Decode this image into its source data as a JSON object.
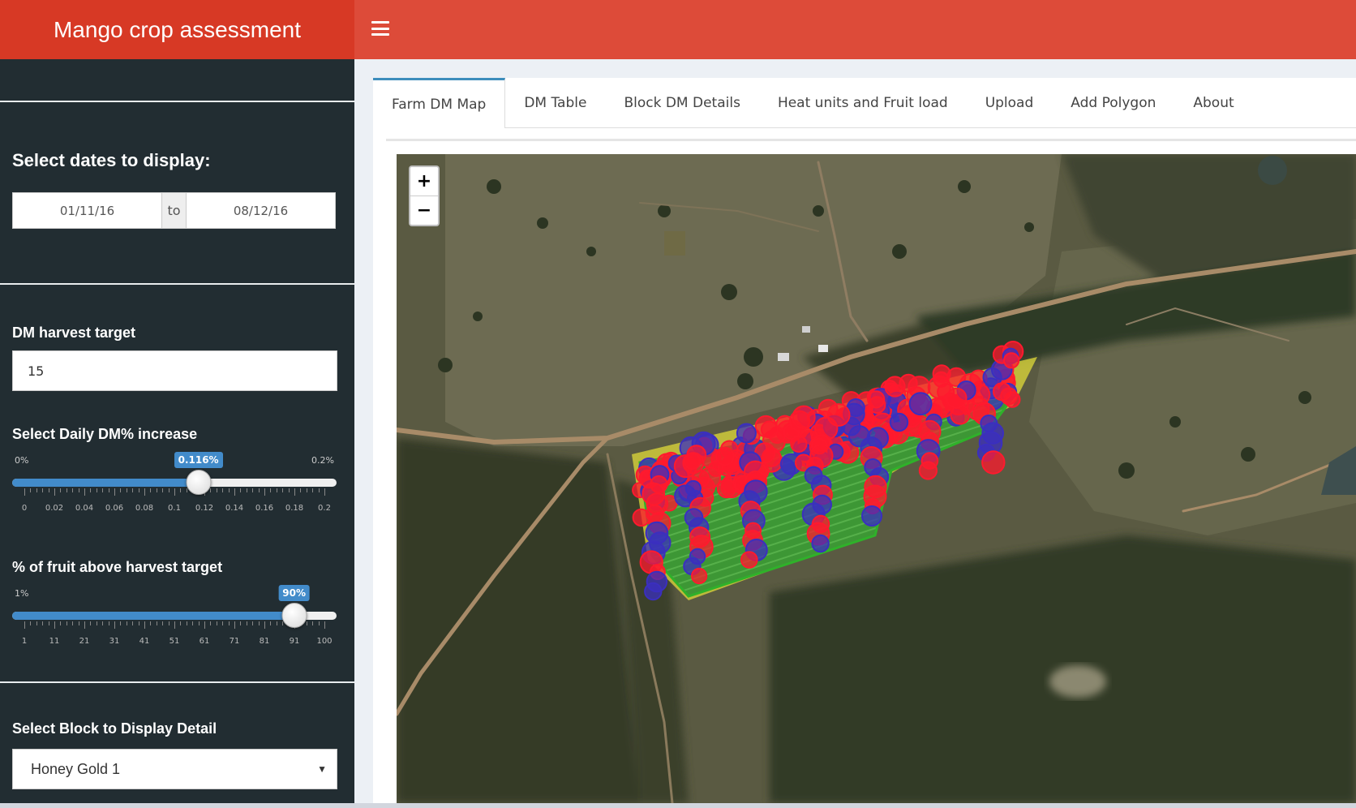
{
  "app": {
    "title": "Mango crop assessment"
  },
  "sidebar": {
    "date_label": "Select dates to display:",
    "date_from": "01/11/16",
    "date_sep": "to",
    "date_to": "08/12/16",
    "dm_target_label": "DM harvest target",
    "dm_target_value": "15",
    "daily_dm": {
      "label": "Select Daily DM% increase",
      "min_label": "0%",
      "max_label": "0.2%",
      "value_label": "0.116%",
      "value": 0.116,
      "min": 0,
      "max": 0.2,
      "ticks": [
        "0",
        "0.02",
        "0.04",
        "0.06",
        "0.08",
        "0.1",
        "0.12",
        "0.14",
        "0.16",
        "0.18",
        "0.2"
      ]
    },
    "fruit_pct": {
      "label": "% of fruit above harvest target",
      "min_label": "1%",
      "value_label": "90%",
      "value": 90,
      "min": 1,
      "max": 100,
      "ticks": [
        "1",
        "11",
        "21",
        "31",
        "41",
        "51",
        "61",
        "71",
        "81",
        "91",
        "100"
      ]
    },
    "block_label": "Select Block to Display Detail",
    "block_value": "Honey Gold 1"
  },
  "tabs": [
    {
      "label": "Farm DM Map",
      "active": true
    },
    {
      "label": "DM Table",
      "active": false
    },
    {
      "label": "Block DM Details",
      "active": false
    },
    {
      "label": "Heat units and Fruit load",
      "active": false
    },
    {
      "label": "Upload",
      "active": false
    },
    {
      "label": "Add Polygon",
      "active": false
    },
    {
      "label": "About",
      "active": false
    }
  ],
  "map": {
    "zoom_in": "+",
    "zoom_out": "−",
    "colors": {
      "above_target": "#ff1a2e",
      "below_target": "#3b2fbf",
      "block_fill": "#3e9a36",
      "block_edge_yellow": "#d7d23a"
    }
  }
}
